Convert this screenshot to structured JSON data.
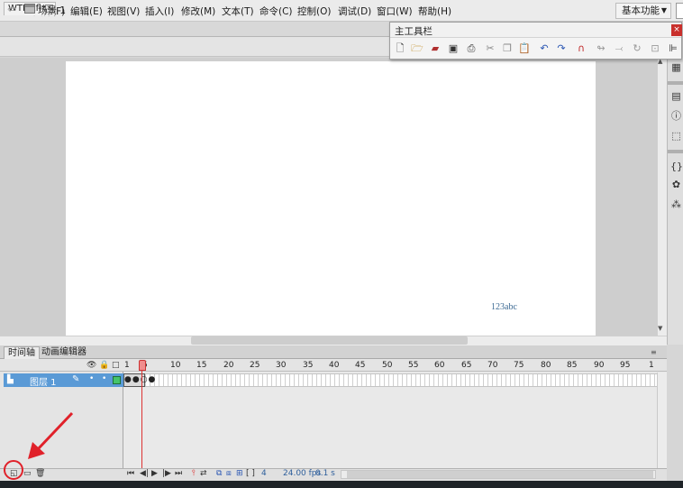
{
  "menubar": {
    "logo": "Fl",
    "items": [
      "文件(F)",
      "编辑(E)",
      "视图(V)",
      "插入(I)",
      "修改(M)",
      "文本(T)",
      "命令(C)",
      "控制(O)",
      "调试(D)",
      "窗口(W)",
      "帮助(H)"
    ],
    "workspace": "基本功能"
  },
  "document": {
    "tab_title": "WTL.xfl*",
    "scene": "场景 1"
  },
  "stage": {
    "text": "123abc"
  },
  "main_toolbar": {
    "title": "主工具栏",
    "close": "×",
    "icons": [
      "new-file-icon",
      "open-folder-icon",
      "bridge-icon",
      "save-icon",
      "print-icon",
      "cut-icon",
      "copy-icon",
      "paste-icon",
      "undo-icon",
      "redo-icon",
      "snap-magnet-icon",
      "smooth-icon",
      "straighten-icon",
      "rotate-icon",
      "scale-icon",
      "align-icon"
    ]
  },
  "timeline": {
    "tabs": [
      "时间轴",
      "动画编辑器"
    ],
    "ruler": [
      "1",
      "5",
      "10",
      "15",
      "20",
      "25",
      "30",
      "35",
      "40",
      "45",
      "50",
      "55",
      "60",
      "65",
      "70",
      "75",
      "80",
      "85",
      "90",
      "95",
      "1"
    ],
    "layer": {
      "name": "图层 1",
      "color": "#45c46a"
    },
    "current_frame": "4",
    "fps": "24.00 fps",
    "time": "0.1 s"
  },
  "colors": {
    "selection": "#5a9ad6",
    "playhead": "#dd3333",
    "annotation": "#e0212a"
  }
}
